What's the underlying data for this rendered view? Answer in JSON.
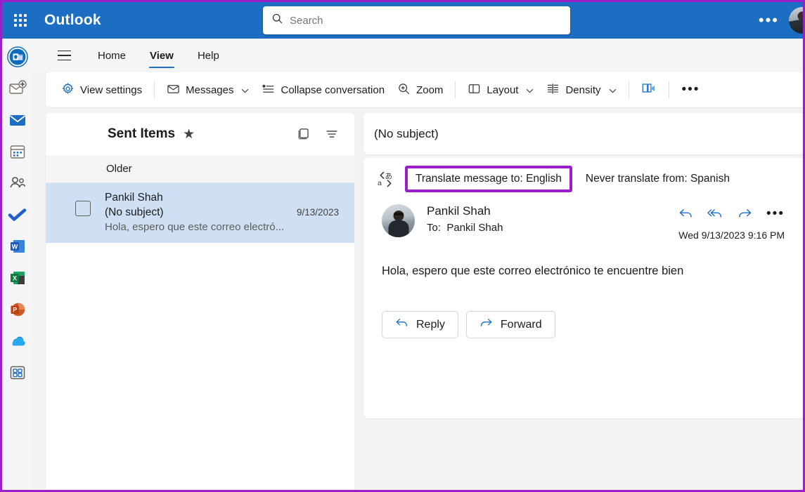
{
  "colors": {
    "header_blue": "#1b6ec2",
    "accent_blue": "#0f6cbd",
    "annotation_purple": "#9b1fc8",
    "selected_row": "#cfe0f5"
  },
  "topbar": {
    "waffle_label": "app-launcher",
    "brand": "Outlook",
    "search": {
      "placeholder": "Search",
      "value": ""
    },
    "more_label": "•••"
  },
  "rail": {
    "items": [
      {
        "name": "outlook",
        "label": "Outlook"
      },
      {
        "name": "new-mail",
        "label": "New mail"
      },
      {
        "name": "mail",
        "label": "Mail"
      },
      {
        "name": "calendar",
        "label": "Calendar"
      },
      {
        "name": "people",
        "label": "People"
      },
      {
        "name": "to-do",
        "label": "To Do"
      },
      {
        "name": "word",
        "label": "Word"
      },
      {
        "name": "excel",
        "label": "Excel"
      },
      {
        "name": "powerpoint",
        "label": "PowerPoint"
      },
      {
        "name": "onedrive",
        "label": "OneDrive"
      },
      {
        "name": "all-apps",
        "label": "More apps"
      }
    ]
  },
  "ribbon": {
    "tabs": [
      {
        "label": "Home",
        "active": false
      },
      {
        "label": "View",
        "active": true
      },
      {
        "label": "Help",
        "active": false
      }
    ],
    "commands": [
      {
        "label": "View settings",
        "icon": "gear-icon",
        "caret": false
      },
      {
        "label": "Messages",
        "icon": "envelope-icon",
        "caret": true
      },
      {
        "label": "Collapse conversation",
        "icon": "collapse-icon",
        "caret": false
      },
      {
        "label": "Zoom",
        "icon": "zoom-icon",
        "caret": false
      },
      {
        "label": "Layout",
        "icon": "layout-icon",
        "caret": true
      },
      {
        "label": "Density",
        "icon": "density-icon",
        "caret": true
      }
    ],
    "immersive_reader_label": "Immersive Reader",
    "overflow_label": "•••"
  },
  "list": {
    "folder_title": "Sent Items",
    "star_glyph": "★",
    "group_label": "Older",
    "messages": [
      {
        "sender": "Pankil Shah",
        "subject": "(No subject)",
        "date": "9/13/2023",
        "preview": "Hola, espero que este correo electró...",
        "selected": true
      }
    ]
  },
  "reading": {
    "subject": "(No subject)",
    "translate": {
      "icon": "translate-icon",
      "translate_link": "Translate message to: English",
      "never_link": "Never translate from: Spanish"
    },
    "message": {
      "sender": "Pankil Shah",
      "to_label": "To:",
      "to_value": "Pankil Shah",
      "timestamp": "Wed 9/13/2023 9:16 PM",
      "body": "Hola, espero que este correo electrónico te encuentre bien",
      "actions": [
        {
          "name": "reply-icon",
          "label": "Reply"
        },
        {
          "name": "reply-all-icon",
          "label": "Reply all"
        },
        {
          "name": "forward-icon",
          "label": "Forward"
        },
        {
          "name": "more-actions",
          "label": "•••"
        }
      ],
      "buttons": [
        {
          "name": "reply-button",
          "label": "Reply",
          "icon": "reply-icon"
        },
        {
          "name": "forward-button",
          "label": "Forward",
          "icon": "forward-icon"
        }
      ]
    }
  }
}
